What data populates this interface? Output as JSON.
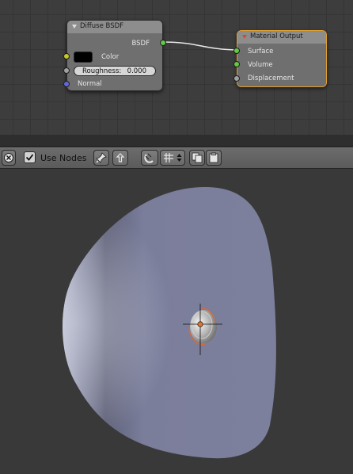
{
  "node_editor": {
    "diffuse_node": {
      "title": "Diffuse BSDF",
      "output_socket": "BSDF",
      "color_label": "Color",
      "roughness_label": "Roughness:",
      "roughness_value": "0.000",
      "normal_label": "Normal",
      "color_value": "#000000"
    },
    "output_node": {
      "title": "Material Output",
      "surface_label": "Surface",
      "volume_label": "Volume",
      "displacement_label": "Displacement"
    },
    "colors": {
      "socket_shader": "#62c845",
      "socket_color": "#c7c72b",
      "socket_value": "#a1a1a1",
      "socket_vector": "#6466d6",
      "active_node_border": "#e0a030"
    }
  },
  "toolbar": {
    "use_nodes_label": "Use Nodes",
    "use_nodes_checked": true,
    "icons": [
      "close-icon",
      "pin-icon",
      "parent-node-icon",
      "snap-magnet-icon",
      "snap-target-icon",
      "copy-icon",
      "paste-icon"
    ]
  },
  "viewport": {
    "object_color": "#7a7d9a"
  }
}
